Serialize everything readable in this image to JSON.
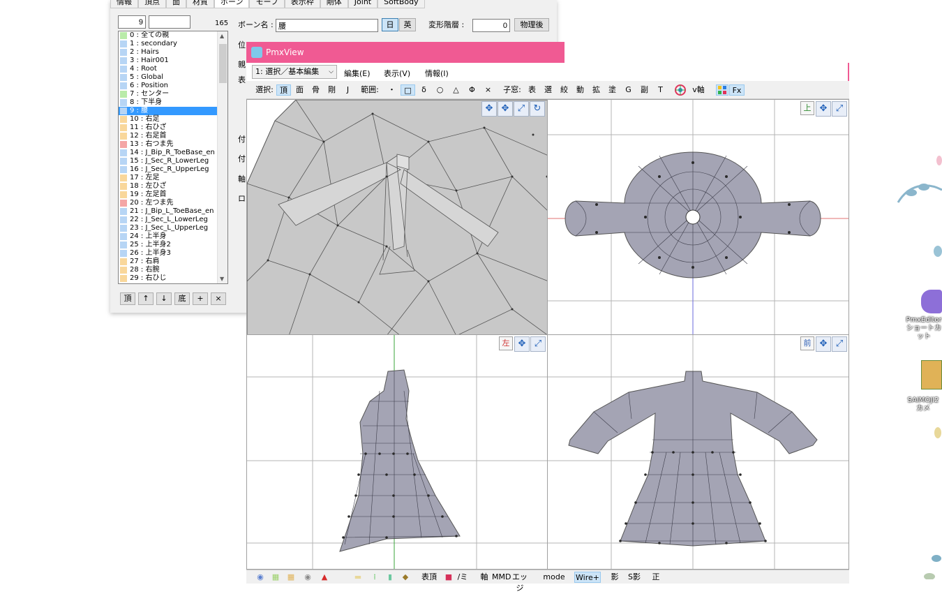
{
  "editor": {
    "tabs": [
      "情報",
      "頂点",
      "面",
      "材質",
      "ボーン",
      "モーフ",
      "表示枠",
      "剛体",
      "Joint",
      "SoftBody"
    ],
    "active_tab": 4,
    "bone_index_value": "9",
    "bone_count": "165",
    "bone_name_label": "ボーン名 :",
    "bone_name_value": "腰",
    "lang_jp": "日",
    "lang_en": "英",
    "deform_layer_label": "変形階層 :",
    "deform_layer_value": "0",
    "after_physics": "物理後",
    "side_labels": [
      "位",
      "親",
      "表",
      "付",
      "付",
      "軸",
      "ロ"
    ],
    "list_buttons": [
      "頂",
      "↑",
      "↓",
      "底",
      "+",
      "×"
    ],
    "bones": [
      {
        "label": "0 : 全ての親",
        "color": "#b9eba9"
      },
      {
        "label": "1 : secondary",
        "color": "#b7d5f5"
      },
      {
        "label": "2 : Hairs",
        "color": "#b7d5f5"
      },
      {
        "label": "3 : Hair001",
        "color": "#b7d5f5"
      },
      {
        "label": "4 : Root",
        "color": "#b7d5f5"
      },
      {
        "label": "5 : Global",
        "color": "#b7d5f5"
      },
      {
        "label": "6 : Position",
        "color": "#b7d5f5"
      },
      {
        "label": "7 : センター",
        "color": "#b9eba9"
      },
      {
        "label": "8 : 下半身",
        "color": "#b7d5f5"
      },
      {
        "label": "9 : 腰",
        "color": "#b7d5f5"
      },
      {
        "label": "10 : 右足",
        "color": "#f9d79b"
      },
      {
        "label": "11 : 右ひざ",
        "color": "#f9d79b"
      },
      {
        "label": "12 : 右足首",
        "color": "#f9d79b"
      },
      {
        "label": "13 : 右つま先",
        "color": "#f4a6a6"
      },
      {
        "label": "14 : J_Bip_R_ToeBase_en",
        "color": "#b7d5f5"
      },
      {
        "label": "15 : J_Sec_R_LowerLeg",
        "color": "#b7d5f5"
      },
      {
        "label": "16 : J_Sec_R_UpperLeg",
        "color": "#b7d5f5"
      },
      {
        "label": "17 : 左足",
        "color": "#f9d79b"
      },
      {
        "label": "18 : 左ひざ",
        "color": "#f9d79b"
      },
      {
        "label": "19 : 左足首",
        "color": "#f9d79b"
      },
      {
        "label": "20 : 左つま先",
        "color": "#f4a6a6"
      },
      {
        "label": "21 : J_Bip_L_ToeBase_en",
        "color": "#b7d5f5"
      },
      {
        "label": "22 : J_Sec_L_LowerLeg",
        "color": "#b7d5f5"
      },
      {
        "label": "23 : J_Sec_L_UpperLeg",
        "color": "#b7d5f5"
      },
      {
        "label": "24 : 上半身",
        "color": "#b7d5f5"
      },
      {
        "label": "25 : 上半身2",
        "color": "#b7d5f5"
      },
      {
        "label": "26 : 上半身3",
        "color": "#b7d5f5"
      },
      {
        "label": "27 : 右肩",
        "color": "#f9d79b"
      },
      {
        "label": "28 : 右腕",
        "color": "#f9d79b"
      },
      {
        "label": "29 : 右ひじ",
        "color": "#f9d79b"
      }
    ],
    "selected_bone": 9
  },
  "viewer": {
    "title": "PmxView",
    "mode_select": "1: 選択／基本編集",
    "menus": [
      "編集(E)",
      "表示(V)",
      "情報(I)"
    ],
    "toolbar": {
      "select_label": "選択:",
      "select_items": [
        "頂",
        "面",
        "骨",
        "剛",
        "J"
      ],
      "range_label": "範囲:",
      "range_items": [
        "・",
        "□",
        "δ",
        "○",
        "△",
        "Φ",
        "×"
      ],
      "child_label": "子窓:",
      "child_items": [
        "表",
        "選",
        "絞",
        "動",
        "拡",
        "塗",
        "G",
        "副",
        "T"
      ],
      "v_axis": "v軸",
      "fx": "Fx"
    },
    "viewports": {
      "top_label": "上",
      "left_label": "左",
      "front_label": "前"
    },
    "bottombar": {
      "items": [
        "表頂",
        "/ミ",
        "軸",
        "MMD",
        "エッジ",
        "mode",
        "Wire+",
        "影",
        "S影",
        "正"
      ]
    }
  },
  "desktop": {
    "icons": [
      {
        "label": "PmxEditor ショートカット"
      },
      {
        "label": "SAIMOJI2 カメ"
      }
    ]
  }
}
